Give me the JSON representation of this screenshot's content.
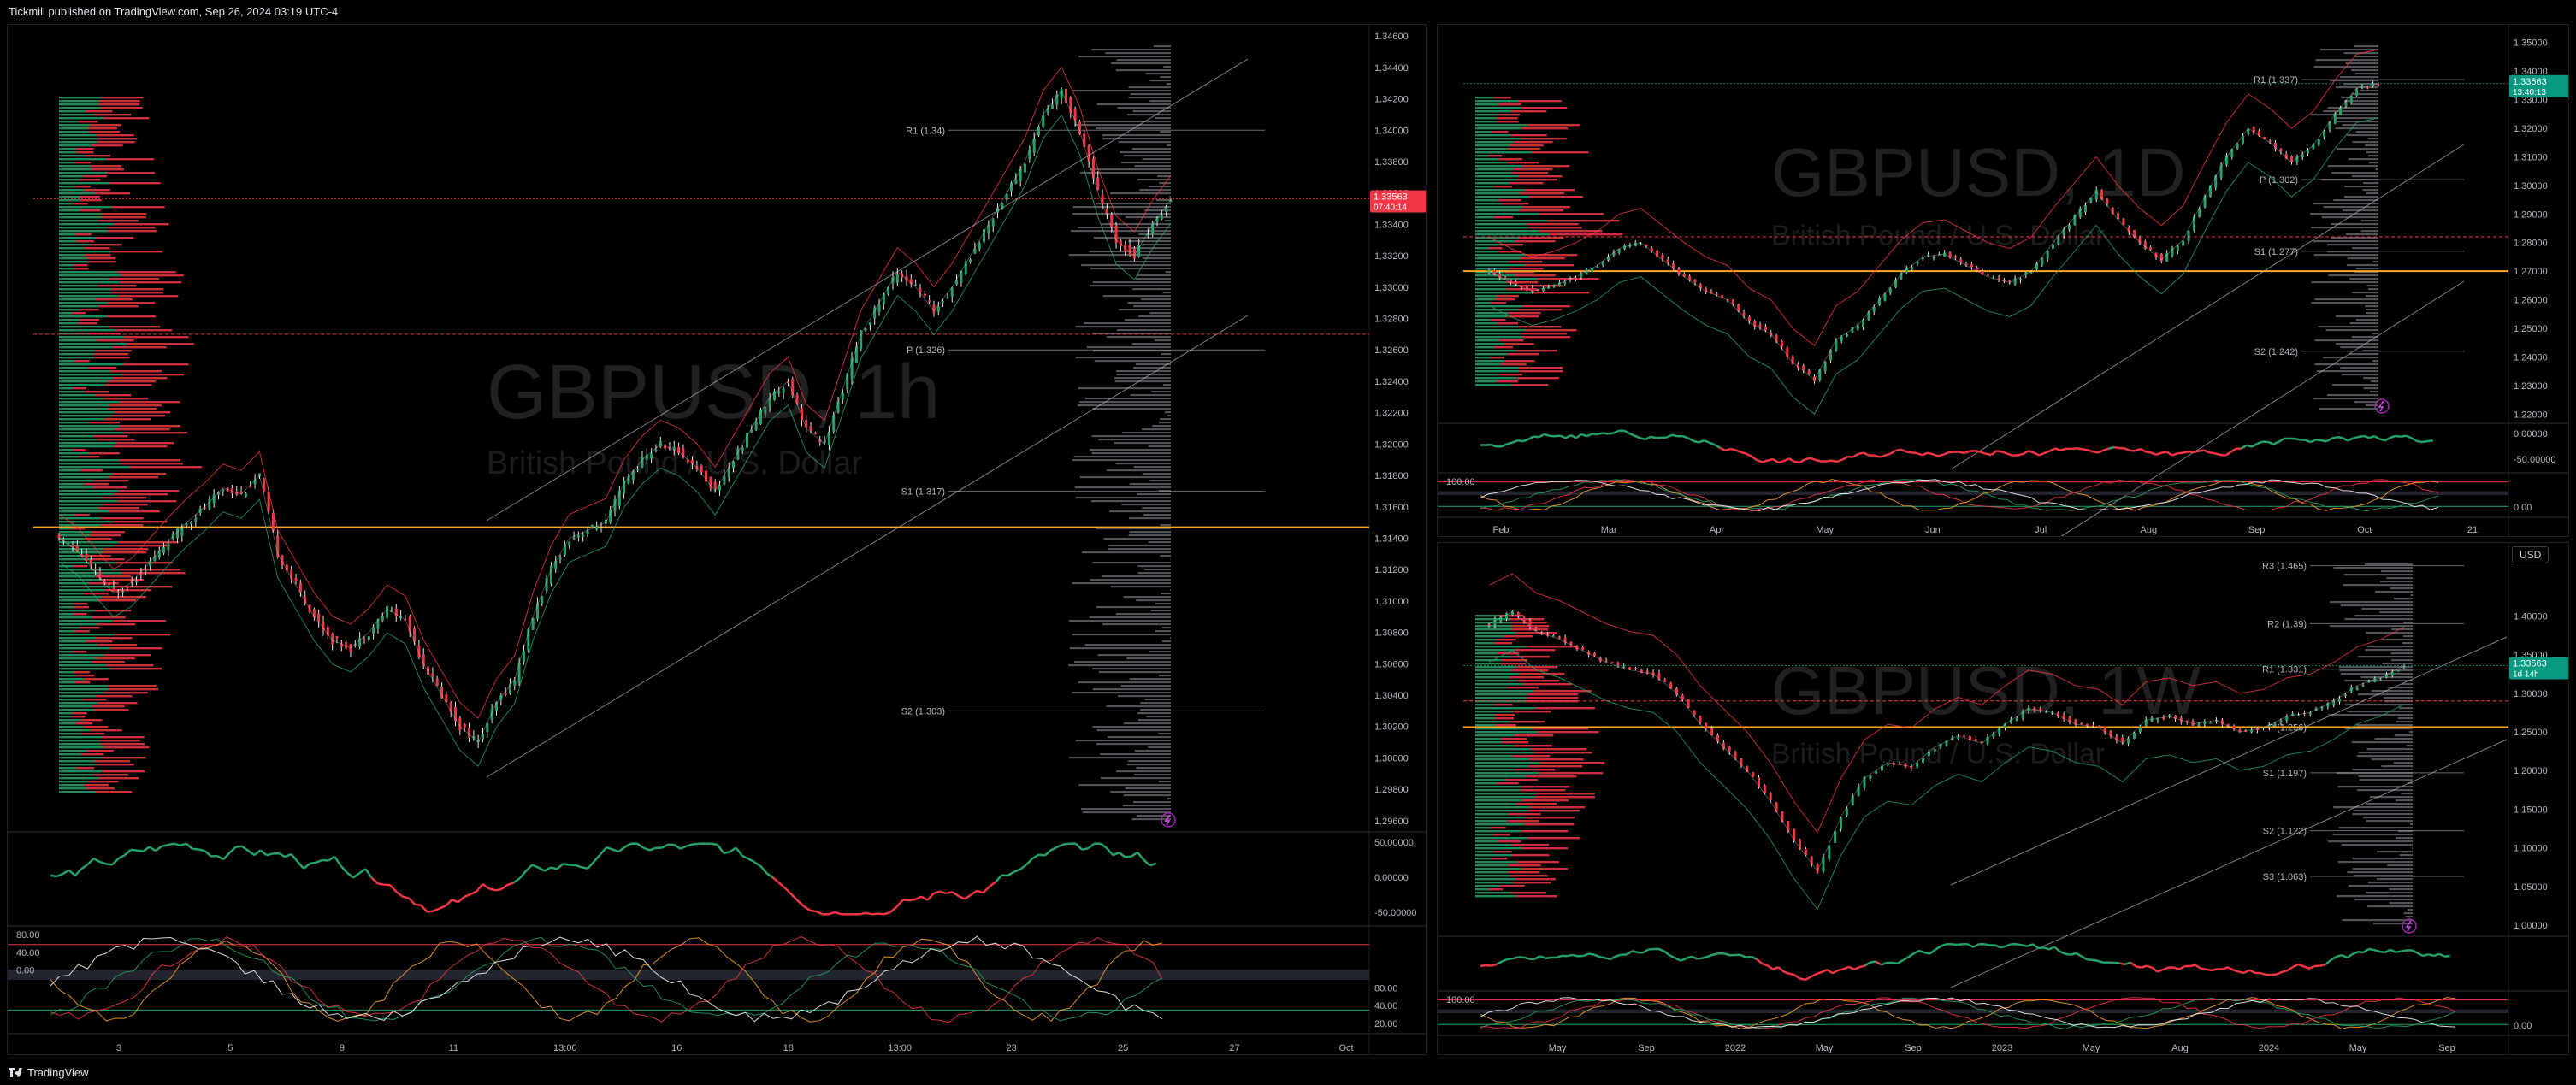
{
  "header": {
    "published": "Tickmill published on TradingView.com, Sep 26, 2024 03:19 UTC-4"
  },
  "footer": {
    "brand": "TradingView"
  },
  "colors": {
    "up": "#26a269",
    "down": "#f23645",
    "orange": "#ffa726",
    "yellow": "#f5d742",
    "grid": "#1c1f26",
    "text": "#b2b5be",
    "price_tag": "#f23645",
    "price_tag_green": "#089981"
  },
  "chart_data": [
    {
      "type": "candlestick",
      "symbol": "GBPUSD",
      "timeframe": "1h",
      "watermark_symbol": "GBPUSD, 1h",
      "watermark_name": "British Pound / U.S. Dollar",
      "x_ticks": [
        "3",
        "5",
        "9",
        "11",
        "13:00",
        "16",
        "18",
        "13:00",
        "23",
        "25",
        "27",
        "Oct"
      ],
      "y_ticks": [
        "1.34600",
        "1.34400",
        "1.34200",
        "1.34000",
        "1.33800",
        "1.33600",
        "1.33400",
        "1.33200",
        "1.33000",
        "1.32800",
        "1.32600",
        "1.32400",
        "1.32200",
        "1.32000",
        "1.31800",
        "1.31600",
        "1.31400",
        "1.31200",
        "1.31000",
        "1.30800",
        "1.30600",
        "1.30400",
        "1.30200",
        "1.30000",
        "1.29800",
        "1.29600"
      ],
      "ylim": [
        1.2955,
        1.3465
      ],
      "last_price": "1.33563",
      "countdown": "07:40:14",
      "pivots": [
        {
          "label": "R1 (1.34)",
          "value": 1.34
        },
        {
          "label": "P (1.326)",
          "value": 1.326
        },
        {
          "label": "S1 (1.317)",
          "value": 1.317
        },
        {
          "label": "S2 (1.303)",
          "value": 1.303
        }
      ],
      "series_close": [
        1.314,
        1.3132,
        1.3118,
        1.3105,
        1.3112,
        1.3125,
        1.3138,
        1.315,
        1.316,
        1.3172,
        1.3168,
        1.318,
        1.313,
        1.311,
        1.309,
        1.3075,
        1.307,
        1.308,
        1.3095,
        1.3088,
        1.306,
        1.304,
        1.302,
        1.301,
        1.3035,
        1.305,
        1.309,
        1.312,
        1.314,
        1.3145,
        1.315,
        1.3175,
        1.319,
        1.32,
        1.3195,
        1.3185,
        1.317,
        1.319,
        1.321,
        1.323,
        1.324,
        1.321,
        1.32,
        1.3235,
        1.327,
        1.329,
        1.331,
        1.33,
        1.3285,
        1.33,
        1.332,
        1.334,
        1.336,
        1.338,
        1.341,
        1.3425,
        1.34,
        1.336,
        1.333,
        1.332,
        1.334,
        1.3356
      ],
      "oscillator_ticks": [
        "50.00000",
        "0.00000",
        "-50.00000"
      ],
      "stoch_ticks": [
        "80.00",
        "40.00",
        "0.00",
        "80.00",
        "40.00",
        "20.00"
      ]
    },
    {
      "type": "candlestick",
      "symbol": "GBPUSD",
      "timeframe": "1D",
      "watermark_symbol": "GBPUSD, 1D",
      "watermark_name": "British Pound / U.S. Dollar",
      "x_ticks": [
        "Feb",
        "Mar",
        "Apr",
        "May",
        "Jun",
        "Jul",
        "Aug",
        "Sep",
        "Oct",
        "21"
      ],
      "y_ticks": [
        "1.35000",
        "1.34000",
        "1.33000",
        "1.32000",
        "1.31000",
        "1.30000",
        "1.29000",
        "1.28000",
        "1.27000",
        "1.26000",
        "1.25000",
        "1.24000",
        "1.23000",
        "1.22000"
      ],
      "ylim": [
        1.218,
        1.355
      ],
      "last_price": "1.33563",
      "countdown": "13:40:13",
      "pivots": [
        {
          "label": "R1 (1.337)",
          "value": 1.337
        },
        {
          "label": "P (1.302)",
          "value": 1.302
        },
        {
          "label": "S1 (1.277)",
          "value": 1.277
        },
        {
          "label": "S2 (1.242)",
          "value": 1.242
        }
      ],
      "series_close": [
        1.27,
        1.266,
        1.263,
        1.265,
        1.268,
        1.272,
        1.278,
        1.28,
        1.274,
        1.268,
        1.263,
        1.26,
        1.252,
        1.248,
        1.238,
        1.232,
        1.246,
        1.251,
        1.26,
        1.269,
        1.275,
        1.276,
        1.272,
        1.268,
        1.266,
        1.27,
        1.28,
        1.289,
        1.298,
        1.288,
        1.28,
        1.274,
        1.281,
        1.296,
        1.31,
        1.32,
        1.315,
        1.308,
        1.314,
        1.325,
        1.334,
        1.3356
      ],
      "oscillator_ticks": [
        "0.00000",
        "-50.00000"
      ],
      "stoch_ticks": [
        "100.00",
        "0.00"
      ]
    },
    {
      "type": "candlestick",
      "symbol": "GBPUSD",
      "timeframe": "1W",
      "watermark_symbol": "GBPUSD, 1W",
      "watermark_name": "British Pound / U.S. Dollar",
      "x_ticks": [
        "May",
        "Sep",
        "2022",
        "May",
        "Sep",
        "2023",
        "May",
        "Aug",
        "2024",
        "May",
        "Sep"
      ],
      "y_ticks": [
        "1.40000",
        "1.35000",
        "1.30000",
        "1.25000",
        "1.20000",
        "1.15000",
        "1.10000",
        "1.05000",
        "1.00000"
      ],
      "ylim": [
        0.99,
        1.49
      ],
      "last_price": "1.33563",
      "countdown": "1d 14h",
      "currency_button": "USD",
      "pivots": [
        {
          "label": "R3 (1.465)",
          "value": 1.465
        },
        {
          "label": "R2 (1.39)",
          "value": 1.39
        },
        {
          "label": "R1 (1.331)",
          "value": 1.331
        },
        {
          "label": "P (1.256)",
          "value": 1.256
        },
        {
          "label": "S1 (1.197)",
          "value": 1.197
        },
        {
          "label": "S2 (1.122)",
          "value": 1.122
        },
        {
          "label": "S3 (1.063)",
          "value": 1.063
        }
      ],
      "series_close": [
        1.39,
        1.405,
        1.38,
        1.37,
        1.355,
        1.34,
        1.33,
        1.325,
        1.3,
        1.26,
        1.23,
        1.2,
        1.16,
        1.11,
        1.07,
        1.14,
        1.19,
        1.21,
        1.205,
        1.23,
        1.245,
        1.235,
        1.26,
        1.28,
        1.275,
        1.26,
        1.255,
        1.235,
        1.265,
        1.27,
        1.26,
        1.265,
        1.25,
        1.255,
        1.27,
        1.275,
        1.29,
        1.31,
        1.32,
        1.3356
      ],
      "oscillator_ticks": [],
      "stoch_ticks": [
        "100.00",
        "0.00"
      ]
    }
  ]
}
